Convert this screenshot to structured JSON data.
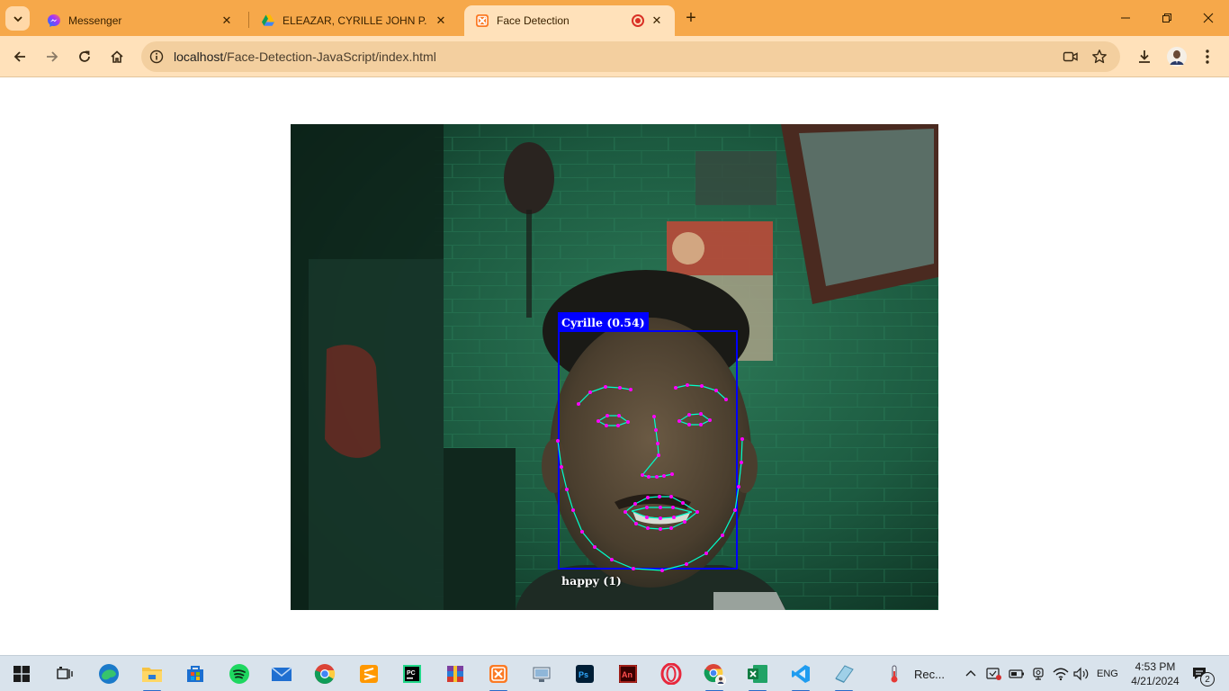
{
  "browser": {
    "tabs": [
      {
        "title": "Messenger",
        "icon": "messenger-icon",
        "active": false
      },
      {
        "title": "ELEAZAR, CYRILLE JOHN P. - G",
        "icon": "google-drive-icon",
        "active": false
      },
      {
        "title": "Face Detection",
        "icon": "xampp-icon",
        "active": true,
        "recording": true
      }
    ],
    "url_host": "localhost",
    "url_path": "/Face-Detection-JavaScript/index.html"
  },
  "detection": {
    "name_label": "Cyrille (0.54)",
    "expression_label": "happy (1)",
    "box_color": "#0000ff",
    "landmark_line_color": "#00ffcc",
    "landmark_point_color": "#ff00ff"
  },
  "taskbar": {
    "pinned": [
      "windows-start-icon",
      "task-view-icon",
      "edge-icon",
      "file-explorer-icon",
      "microsoft-store-icon",
      "spotify-icon",
      "mail-icon",
      "chrome-icon",
      "sublime-text-icon",
      "pycharm-icon",
      "winrar-icon",
      "xampp-icon",
      "remote-desktop-icon",
      "photoshop-icon",
      "animate-icon",
      "opera-icon",
      "chrome-profile-icon",
      "excel-icon",
      "vscode-icon",
      "notepad-icon"
    ],
    "tray_app": "Rec...",
    "language": "ENG",
    "time": "4:53 PM",
    "date": "4/21/2024",
    "notification_count": "2"
  }
}
